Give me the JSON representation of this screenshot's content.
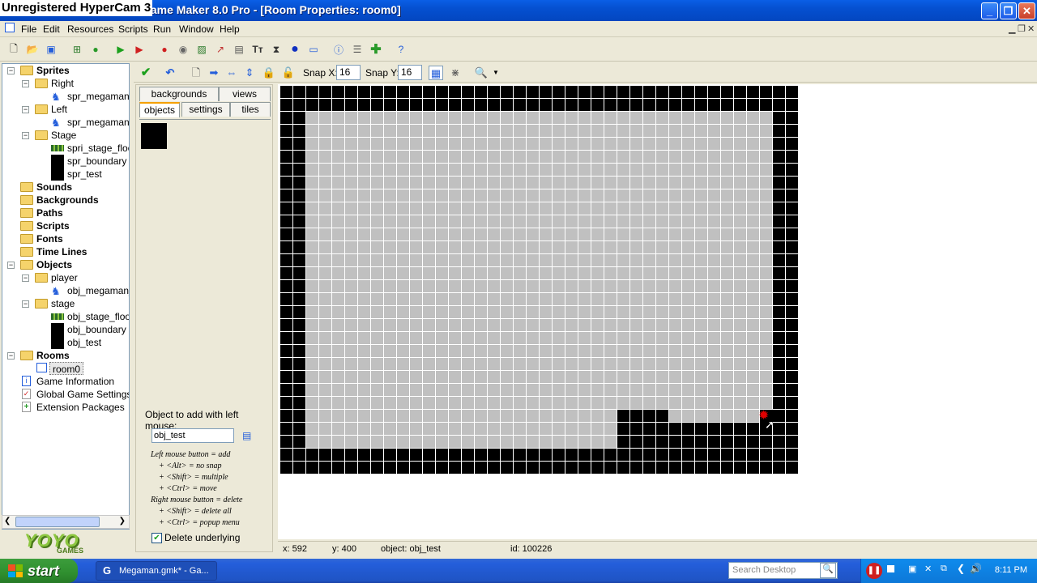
{
  "overlay": {
    "watermark": "Unregistered HyperCam 3"
  },
  "window": {
    "title": "Megaman.gmk* - Game Maker 8.0 Pro - [Room Properties: room0]",
    "visible_title": "Megaman.gmk* - Game Maker 8.0 Pro - [Room Properties: room0]",
    "title_tail": "Game Maker 8.0 Pro - [Room Properties: room0]"
  },
  "menu": {
    "file": "File",
    "edit": "Edit",
    "resources": "Resources",
    "scripts": "Scripts",
    "run": "Run",
    "window": "Window",
    "help": "Help"
  },
  "tree": {
    "sprites": "Sprites",
    "right": "Right",
    "spr_megaman_right": "spr_megaman_s",
    "left": "Left",
    "spr_megaman_left": "spr_megaman_s",
    "stage": "Stage",
    "spr_stage_floor": "spri_stage_floor",
    "spr_boundary": "spr_boundary",
    "spr_test": "spr_test",
    "sounds": "Sounds",
    "backgrounds": "Backgrounds",
    "paths": "Paths",
    "scripts": "Scripts",
    "fonts": "Fonts",
    "timelines": "Time Lines",
    "objects": "Objects",
    "player": "player",
    "obj_megaman": "obj_megaman_r",
    "stage_grp": "stage",
    "obj_stage_floor": "obj_stage_floor",
    "obj_boundary": "obj_boundary",
    "obj_test": "obj_test",
    "rooms": "Rooms",
    "room0": "room0",
    "game_info": "Game Information",
    "global_settings": "Global Game Settings",
    "extensions": "Extension Packages"
  },
  "logo": {
    "main": "YOYO",
    "sub": "GAMES"
  },
  "roomtoolbar": {
    "snapx_label": "Snap X:",
    "snapx": "16",
    "snapy_label": "Snap Y:",
    "snapy": "16"
  },
  "panel": {
    "tabs": {
      "backgrounds": "backgrounds",
      "views": "views",
      "objects": "objects",
      "settings": "settings",
      "tiles": "tiles"
    },
    "object_label": "Object to add with left mouse:",
    "object_value": "obj_test",
    "help": [
      "Left mouse button = add",
      "+ <Alt> = no snap",
      "+ <Shift> = multiple",
      "+ <Ctrl> = move",
      "Right mouse button = delete",
      "+ <Shift> = delete all",
      "+ <Ctrl> = popup menu"
    ],
    "delete_underlying": "Delete underlying"
  },
  "status": {
    "x": "x: 592",
    "y": "y: 400",
    "object": "object: obj_test",
    "id": "id: 100226"
  },
  "taskbar": {
    "start": "start",
    "task": "Megaman.gmk* - Ga...",
    "search_placeholder": "Search Desktop",
    "clock": "8:11 PM"
  },
  "colors": {
    "title_blue": "#0550d0",
    "floor_gray": "#c0c0c0",
    "wall_black": "#000000",
    "start_green": "#2f8f2f"
  }
}
